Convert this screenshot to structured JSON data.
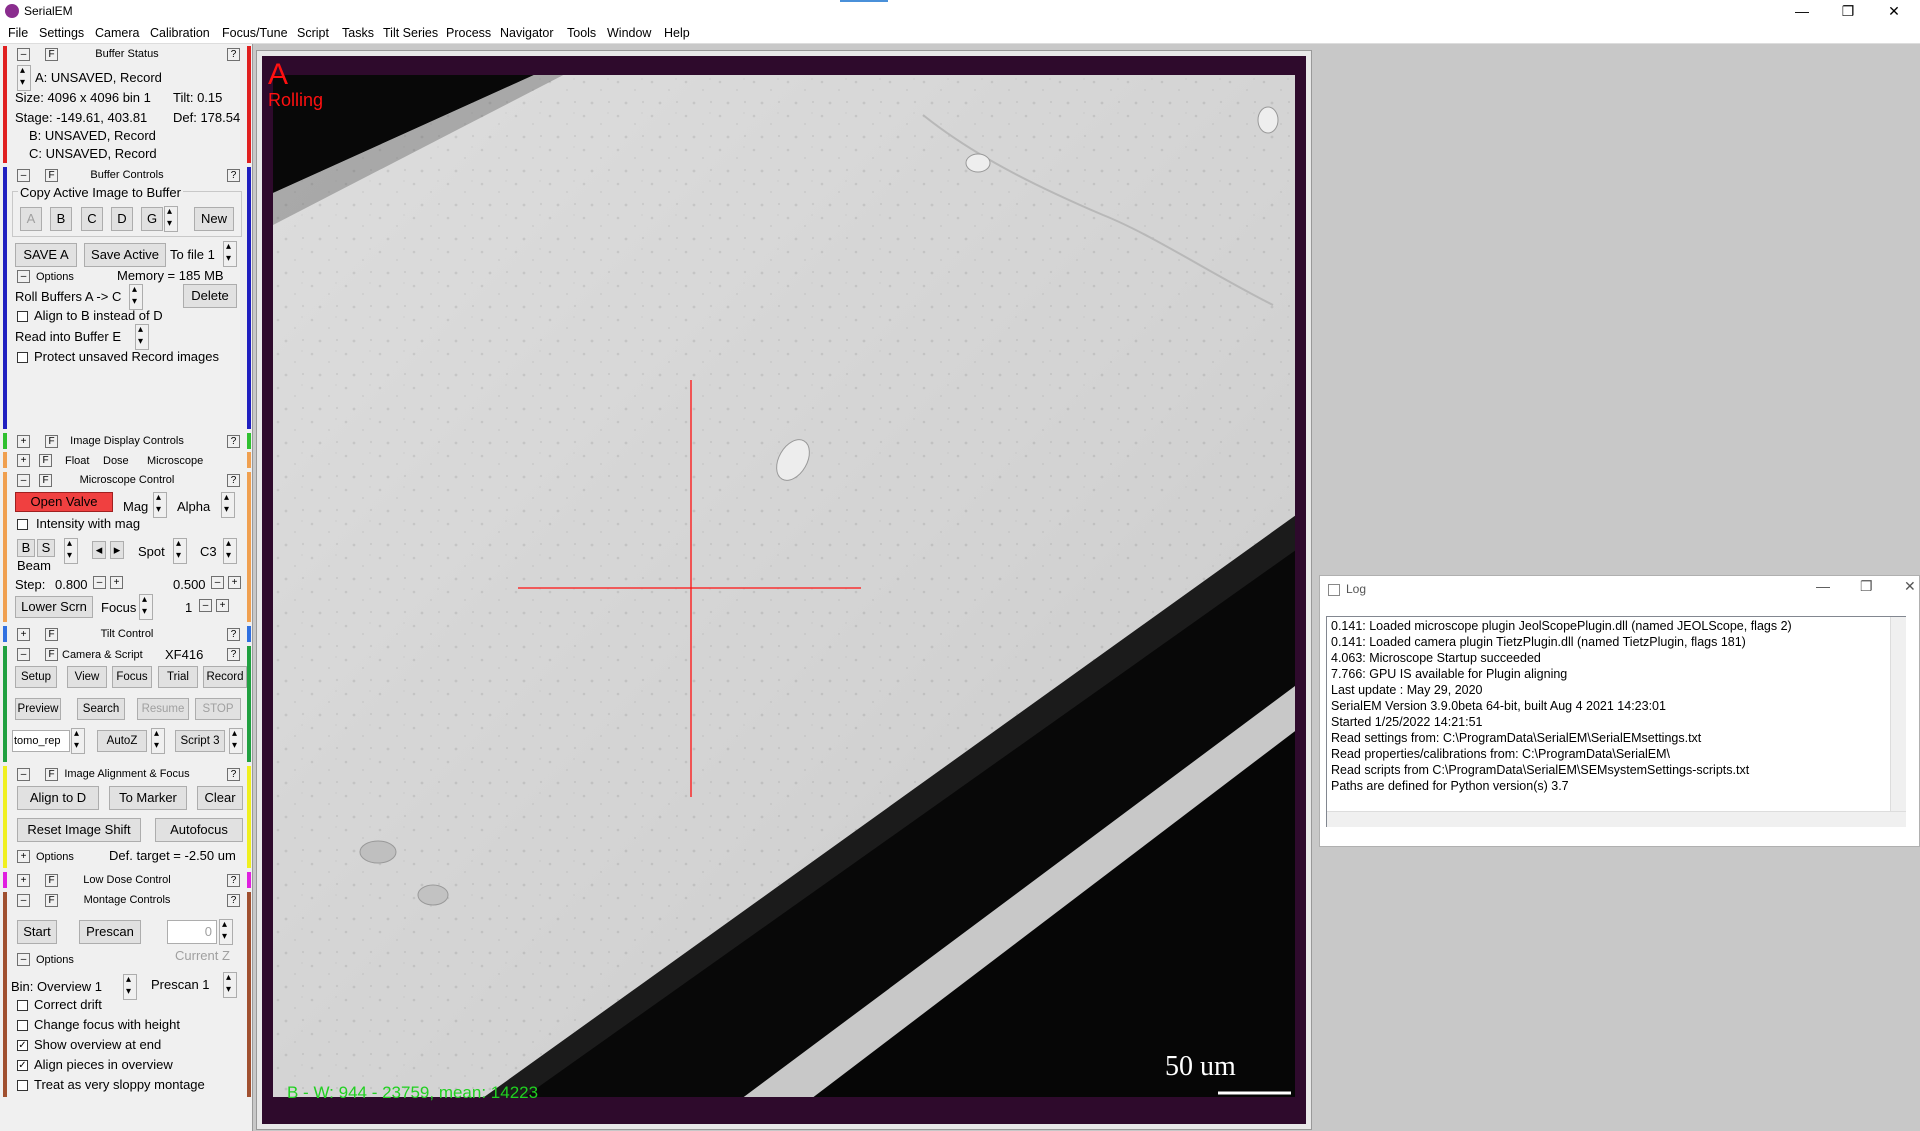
{
  "window": {
    "title": "SerialEM",
    "min": "—",
    "max": "❐",
    "close": "✕"
  },
  "menu": [
    "File",
    "Settings",
    "Camera",
    "Calibration",
    "Focus/Tune",
    "Script",
    "Tasks",
    "Tilt Series",
    "Process",
    "Navigator",
    "Tools",
    "Window",
    "Help"
  ],
  "common": {
    "minus": "–",
    "plus": "+",
    "f": "F",
    "q": "?"
  },
  "buffer_status": {
    "title": "Buffer Status",
    "line1": "A: UNSAVED, Record",
    "size": "Size: 4096 x 4096  bin 1",
    "tilt": "Tilt: 0.15",
    "stage": "Stage: -149.61, 403.81",
    "def": "Def: 178.54",
    "line_b": "B: UNSAVED, Record",
    "line_c": "C: UNSAVED, Record"
  },
  "buffer_controls": {
    "title": "Buffer Controls",
    "group": "Copy Active Image to Buffer",
    "buttons": [
      "A",
      "B",
      "C",
      "D",
      "G"
    ],
    "new": "New",
    "save_a": "SAVE A",
    "save_active": "Save Active",
    "to_file": "To file 1",
    "options": "Options",
    "memory": "Memory = 185 MB",
    "roll": "Roll Buffers A ->  C",
    "delete": "Delete",
    "align_b": "Align to B instead of D",
    "read_into": "Read into Buffer   E",
    "protect": "Protect unsaved Record images"
  },
  "image_display": {
    "title": "Image Display Controls",
    "float": "Float",
    "dose": "Dose",
    "microscope": "Microscope"
  },
  "microscope_control": {
    "title": "Microscope Control",
    "open_valve": "Open Valve",
    "mag": "Mag",
    "alpha": "Alpha",
    "intensity": "Intensity with mag",
    "b": "B",
    "s": "S",
    "beam": "Beam",
    "spot": "Spot",
    "c3": "C3",
    "step_label": "Step:",
    "step1": "0.800",
    "step2": "0.500",
    "lower_scrn": "Lower Scrn",
    "focus": "Focus",
    "one": "1",
    "left_arrow": "◂",
    "right_arrow": "▸"
  },
  "tilt_control": {
    "title": "Tilt Control"
  },
  "camera_script": {
    "title": "Camera & Script",
    "camera": "XF416",
    "setup": "Setup",
    "view": "View",
    "focus": "Focus",
    "trial": "Trial",
    "record": "Record",
    "preview": "Preview",
    "search": "Search",
    "resume": "Resume",
    "stop": "STOP",
    "script_sel": "tomo_rep",
    "autoz": "AutoZ",
    "script3": "Script 3"
  },
  "image_alignment": {
    "title": "Image Alignment & Focus",
    "align_d": "Align to D",
    "to_marker": "To Marker",
    "clear": "Clear",
    "reset_shift": "Reset Image Shift",
    "autofocus": "Autofocus",
    "options": "Options",
    "def_target": "Def. target = -2.50 um"
  },
  "low_dose": {
    "title": "Low Dose Control"
  },
  "montage": {
    "title": "Montage Controls",
    "start": "Start",
    "prescan": "Prescan",
    "zero": "0",
    "current_z": "Current Z",
    "options": "Options",
    "bin_overview": "Bin: Overview 1",
    "prescan1": "Prescan 1",
    "correct_drift": "Correct drift",
    "change_focus": "Change focus with height",
    "show_overview": "Show overview at end",
    "align_pieces": "Align pieces in overview",
    "treat_sloppy": "Treat as very sloppy montage",
    "check": "✓"
  },
  "image": {
    "buffer_letter": "A",
    "rolling": "Rolling",
    "scale_bar": "50 um",
    "stats": "B - W: 944 - 23759, mean: 14223"
  },
  "log": {
    "title": "Log",
    "lines": [
      "0.141: Loaded microscope plugin JeolScopePlugin.dll (named JEOLScope, flags 2)",
      "0.141: Loaded camera plugin TietzPlugin.dll (named TietzPlugin, flags 181)",
      "4.063: Microscope Startup succeeded",
      "7.766: GPU IS available for Plugin aligning",
      "Last update : May 29, 2020",
      "SerialEM Version 3.9.0beta 64-bit,  built Aug  4 2021  14:23:01",
      "Started  1/25/2022  14:21:51",
      "Read settings from: C:\\ProgramData\\SerialEM\\SerialEMsettings.txt",
      "Read properties/calibrations from: C:\\ProgramData\\SerialEM\\",
      "Read scripts from C:\\ProgramData\\SerialEM\\SEMsystemSettings-scripts.txt",
      "Paths are defined for Python version(s)  3.7"
    ]
  },
  "colors": {
    "buffer_status": "#e02020",
    "buffer_controls": "#2020c0",
    "image_display": "#30c030",
    "microscope": "#f0a050",
    "tilt": "#3070e0",
    "camera": "#20a040",
    "alignment": "#f0f020",
    "lowdose": "#e020e0",
    "montage": "#a05030",
    "purple_frame": "#2e0a2c",
    "stats": "#20d020",
    "overlay_red": "#ff1010"
  }
}
